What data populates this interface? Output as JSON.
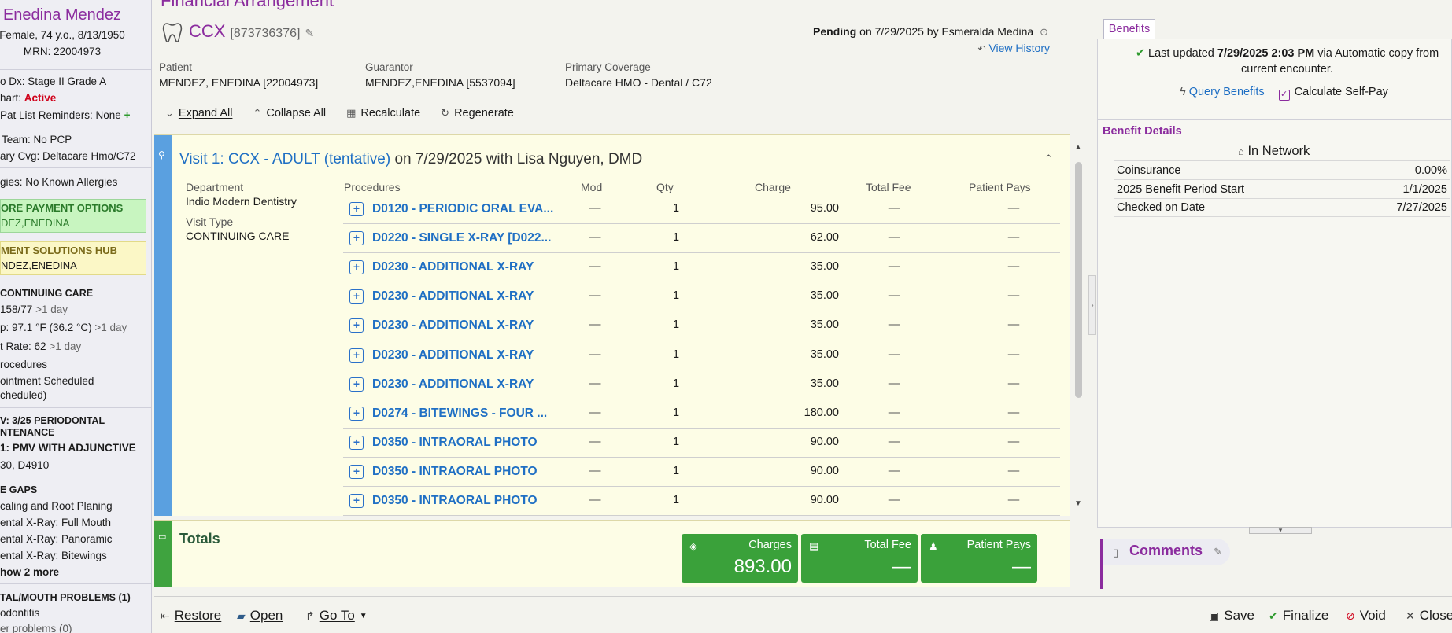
{
  "sidebar": {
    "patient_name": "Enedina Mendez",
    "demographics": "Female, 74 y.o., 8/13/1950",
    "mrn": "MRN: 22004973",
    "dx": "o Dx: Stage II Grade A",
    "chart_prefix": "hart:",
    "chart_status": "Active",
    "reminders": "Pat List Reminders: None",
    "team": "Team: No PCP",
    "coverage": "ary Cvg: Deltacare Hmo/C72",
    "allergies": "gies: No Known Allergies",
    "payment_options_title": "ORE PAYMENT OPTIONS",
    "payment_options_name": "DEZ,ENEDINA",
    "payment_hub_title": "MENT SOLUTIONS HUB",
    "payment_hub_name": "NDEZ,ENEDINA",
    "continuing_care_title": "CONTINUING CARE",
    "bp_value": "158/77",
    "bp_age": ">1 day",
    "temp_prefix": "p:",
    "temp_value": "97.1 °F (36.2 °C)",
    "temp_age": ">1 day",
    "rate_prefix": "t Rate:",
    "rate_value": "62",
    "rate_age": ">1 day",
    "procedures": "rocedures",
    "appointment_1": "ointment Scheduled",
    "appointment_2": "cheduled)",
    "periodontal_1": "V: 3/25 PERIODONTAL",
    "periodontal_2": "NTENANCE",
    "pmv": "1: PMV WITH ADJUNCTIVE",
    "codes": "30, D4910",
    "gaps_title": "E GAPS",
    "gap_1": "caling and Root Planing",
    "gap_2": "ental X-Ray: Full Mouth",
    "gap_3": "ental X-Ray: Panoramic",
    "gap_4": "ental X-Ray: Bitewings",
    "show_more": "how 2 more",
    "problems_title": "TAL/MOUTH PROBLEMS (1)",
    "problem_1": "odontitis",
    "problem_2": "er problems (0)"
  },
  "header": {
    "title": "Financial Arrangement",
    "code": "CCX",
    "encounter_number": "[873736376]",
    "status_word": "Pending",
    "status_rest": "on 7/29/2025 by Esmeralda Medina",
    "view_history": "View History",
    "patient_label": "Patient",
    "patient_value": "MENDEZ, ENEDINA [22004973]",
    "guarantor_label": "Guarantor",
    "guarantor_value": "MENDEZ,ENEDINA [5537094]",
    "coverage_label": "Primary Coverage",
    "coverage_value": "Deltacare HMO - Dental / C72"
  },
  "toolbar": {
    "expand_all": "Expand All",
    "collapse_all": "Collapse All",
    "recalculate": "Recalculate",
    "regenerate": "Regenerate"
  },
  "visit": {
    "title_link": "Visit 1: CCX - ADULT (tentative)",
    "title_rest": "on 7/29/2025 with Lisa Nguyen, DMD",
    "department_label": "Department",
    "department_value": "Indio Modern Dentistry",
    "visit_type_label": "Visit Type",
    "visit_type_value": "CONTINUING CARE",
    "columns": {
      "procedures": "Procedures",
      "mod": "Mod",
      "qty": "Qty",
      "charge": "Charge",
      "total_fee": "Total Fee",
      "patient_pays": "Patient Pays"
    },
    "rows": [
      {
        "procedure": "D0120 - PERIODIC ORAL EVA...",
        "mod": "—",
        "qty": "1",
        "charge": "95.00",
        "total_fee": "—",
        "patient_pays": "—"
      },
      {
        "procedure": "D0220 - SINGLE X-RAY [D022...",
        "mod": "—",
        "qty": "1",
        "charge": "62.00",
        "total_fee": "—",
        "patient_pays": "—"
      },
      {
        "procedure": "D0230 - ADDITIONAL X-RAY",
        "mod": "—",
        "qty": "1",
        "charge": "35.00",
        "total_fee": "—",
        "patient_pays": "—"
      },
      {
        "procedure": "D0230 - ADDITIONAL X-RAY",
        "mod": "—",
        "qty": "1",
        "charge": "35.00",
        "total_fee": "—",
        "patient_pays": "—"
      },
      {
        "procedure": "D0230 - ADDITIONAL X-RAY",
        "mod": "—",
        "qty": "1",
        "charge": "35.00",
        "total_fee": "—",
        "patient_pays": "—"
      },
      {
        "procedure": "D0230 - ADDITIONAL X-RAY",
        "mod": "—",
        "qty": "1",
        "charge": "35.00",
        "total_fee": "—",
        "patient_pays": "—"
      },
      {
        "procedure": "D0230 - ADDITIONAL X-RAY",
        "mod": "—",
        "qty": "1",
        "charge": "35.00",
        "total_fee": "—",
        "patient_pays": "—"
      },
      {
        "procedure": "D0274 - BITEWINGS - FOUR ...",
        "mod": "—",
        "qty": "1",
        "charge": "180.00",
        "total_fee": "—",
        "patient_pays": "—"
      },
      {
        "procedure": "D0350 - INTRAORAL PHOTO",
        "mod": "—",
        "qty": "1",
        "charge": "90.00",
        "total_fee": "—",
        "patient_pays": "—"
      },
      {
        "procedure": "D0350 - INTRAORAL PHOTO",
        "mod": "—",
        "qty": "1",
        "charge": "90.00",
        "total_fee": "—",
        "patient_pays": "—"
      },
      {
        "procedure": "D0350 - INTRAORAL PHOTO",
        "mod": "—",
        "qty": "1",
        "charge": "90.00",
        "total_fee": "—",
        "patient_pays": "—"
      }
    ]
  },
  "totals": {
    "title": "Totals",
    "charges_label": "Charges",
    "charges_value": "893.00",
    "total_fee_label": "Total Fee",
    "total_fee_value": "—",
    "patient_pays_label": "Patient Pays",
    "patient_pays_value": "—"
  },
  "footer": {
    "restore": "Restore",
    "open": "Open",
    "go_to": "Go To",
    "save": "Save",
    "finalize": "Finalize",
    "void": "Void",
    "close": "Close"
  },
  "benefits": {
    "tab_label": "Benefits",
    "last_updated_prefix": "Last updated",
    "last_updated_time": "7/29/2025 2:03 PM",
    "last_updated_suffix": "via Automatic copy from",
    "last_updated_line2": "current encounter.",
    "query_benefits": "Query Benefits",
    "calculate_self_pay": "Calculate Self-Pay",
    "details_title": "Benefit Details",
    "network": "In Network",
    "rows": [
      {
        "label": "Coinsurance",
        "value": "0.00%"
      },
      {
        "label": "2025 Benefit Period Start",
        "value": "1/1/2025"
      },
      {
        "label": "Checked on Date",
        "value": "7/27/2025"
      }
    ]
  },
  "comments": {
    "title": "Comments"
  },
  "icons": {
    "tooth": "tooth-icon",
    "pencil": "pencil-icon",
    "history": "history-icon",
    "expand": "expand-all-icon",
    "collapse": "collapse-all-icon",
    "recalculate": "calculator-icon",
    "regenerate": "refresh-icon",
    "add": "expand-row-icon",
    "charges": "coins-icon",
    "total_fee": "receipt-icon",
    "patient_pays": "person-icon",
    "restore": "restore-icon",
    "open": "folder-icon",
    "go_to": "goto-icon",
    "save": "save-icon",
    "finalize": "check-icon",
    "void": "void-icon",
    "close": "close-icon",
    "query": "lightning-icon",
    "home": "home-icon",
    "comments": "document-icon"
  },
  "colors": {
    "brand_purple": "#8b2c9e",
    "link_blue": "#1f6fc4",
    "visit_stripe": "#5aa0e0",
    "totals_green": "#3aa13a",
    "active_red": "#d0021b"
  }
}
